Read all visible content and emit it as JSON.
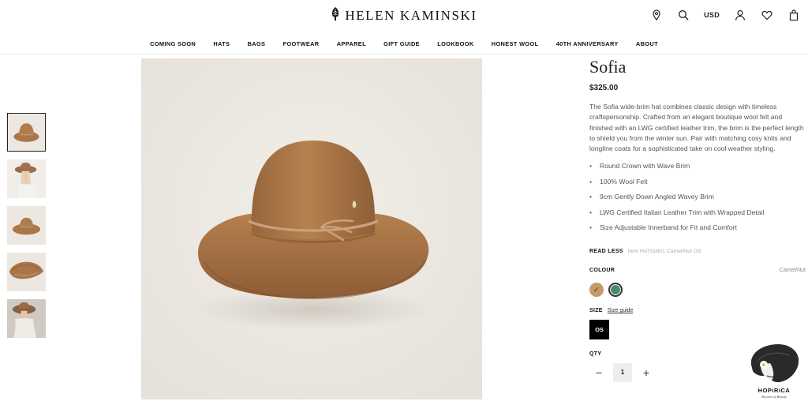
{
  "brand": {
    "name": "HELEN KAMINSKI",
    "logo_icon": "palm-leaf-icon"
  },
  "header": {
    "currency": "USD",
    "icons": [
      "location-pin-icon",
      "search-icon",
      "account-icon",
      "heart-icon",
      "bag-icon"
    ]
  },
  "nav": {
    "items": [
      "COMING SOON",
      "HATS",
      "BAGS",
      "FOOTWEAR",
      "APPAREL",
      "GIFT GUIDE",
      "LOOKBOOK",
      "HONEST WOOL",
      "40TH ANNIVERSARY",
      "ABOUT"
    ]
  },
  "product": {
    "title": "Sofia",
    "price": "$325.00",
    "description": "The Sofia wide-brim hat combines classic design with timeless craftspersonship. Crafted from an elegant boutique wool felt and finished with an LWG certified leather trim, the brim is the perfect length to shield you from the winter sun. Pair with matching cosy knits and longline coats for a sophisticated take on cool weather styling.",
    "features": [
      "Round Crown with Wave Brim",
      "100% Wool Felt",
      "9cm Gently Down Angled Wavey Brim",
      "LWG Certified Italian Leather Trim with Wrapped Detail",
      "Size Adjustable Innerband for Fit and Comfort"
    ],
    "read_less": "READ LESS",
    "item_code": "Item HAT51601 Camel/Nut OS",
    "colour_label": "COLOUR",
    "colour_value": "Camel/Nut",
    "swatches": [
      {
        "name": "Camel/Nut",
        "color": "#c79a68",
        "selected": true
      },
      {
        "name": "Green",
        "color": "#4d8a6b",
        "selected": false
      }
    ],
    "size_label": "SIZE",
    "size_guide": "Size guide",
    "size_option": "OS",
    "qty_label": "QTY",
    "qty_minus": "−",
    "qty_value": "1",
    "qty_plus": "+"
  },
  "watermark": {
    "name": "HOPiRiCA",
    "tagline": "Beyond of Beauty"
  },
  "colors": {
    "hat": "#a8764a",
    "band": "#c29a74",
    "background": "#ece8e1"
  }
}
